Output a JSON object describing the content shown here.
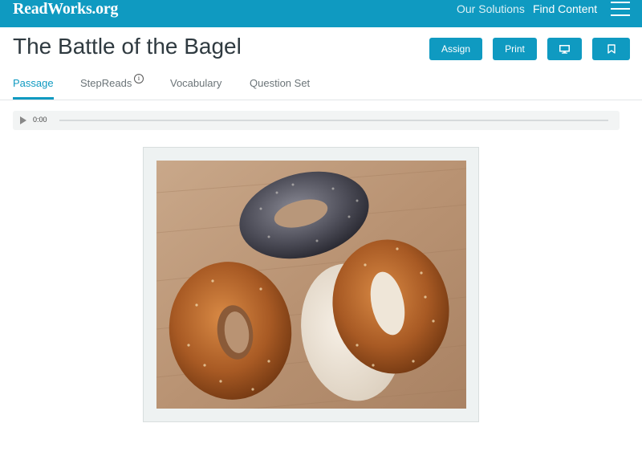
{
  "header": {
    "logo": "ReadWorks.org",
    "nav": {
      "our_solutions": "Our Solutions",
      "find_content": "Find Content"
    },
    "menu_icon": "hamburger-menu-icon"
  },
  "article": {
    "title": "The Battle of the Bagel",
    "actions": {
      "assign": "Assign",
      "print": "Print",
      "present_icon": "monitor-icon",
      "bookmark_icon": "bookmark-icon"
    }
  },
  "tabs": [
    {
      "label": "Passage",
      "active": true
    },
    {
      "label": "StepReads",
      "icon": "info-icon"
    },
    {
      "label": "Vocabulary"
    },
    {
      "label": "Question Set"
    }
  ],
  "audio_player": {
    "time": "0:00",
    "play_icon": "play-icon"
  },
  "colors": {
    "brand": "#0f9ac1",
    "title_text": "#2f3a40",
    "tab_text": "#6b7478"
  }
}
